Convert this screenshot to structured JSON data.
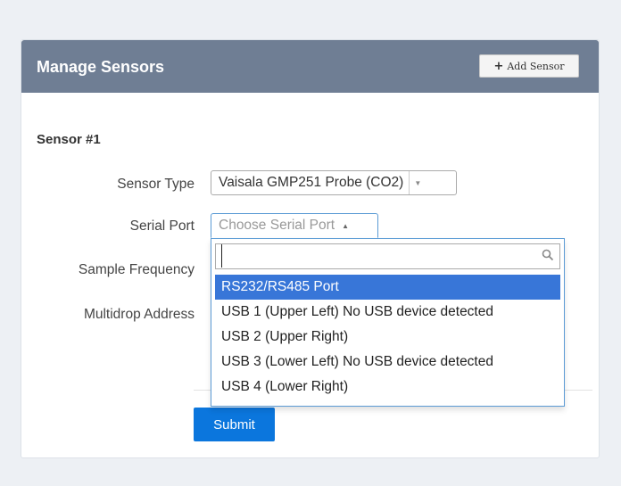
{
  "panel": {
    "title": "Manage Sensors",
    "add_button_label": "Add Sensor"
  },
  "sensor": {
    "heading": "Sensor #1",
    "fields": {
      "sensor_type_label": "Sensor Type",
      "sensor_type_value": "Vaisala GMP251 Probe (CO2)",
      "serial_port_label": "Serial Port",
      "serial_port_placeholder": "Choose Serial Port",
      "sample_frequency_label": "Sample Frequency",
      "multidrop_address_label": "Multidrop Address"
    }
  },
  "dropdown": {
    "search_value": "",
    "options": [
      "RS232/RS485 Port",
      "USB 1 (Upper Left) No USB device detected",
      "USB 2 (Upper Right)",
      "USB 3 (Lower Left) No USB device detected",
      "USB 4 (Lower Right)"
    ],
    "highlighted_index": 0
  },
  "form": {
    "submit_label": "Submit"
  },
  "colors": {
    "header_bg": "#6f7e94",
    "highlight": "#3876d8",
    "submit_bg": "#0b76dd"
  }
}
